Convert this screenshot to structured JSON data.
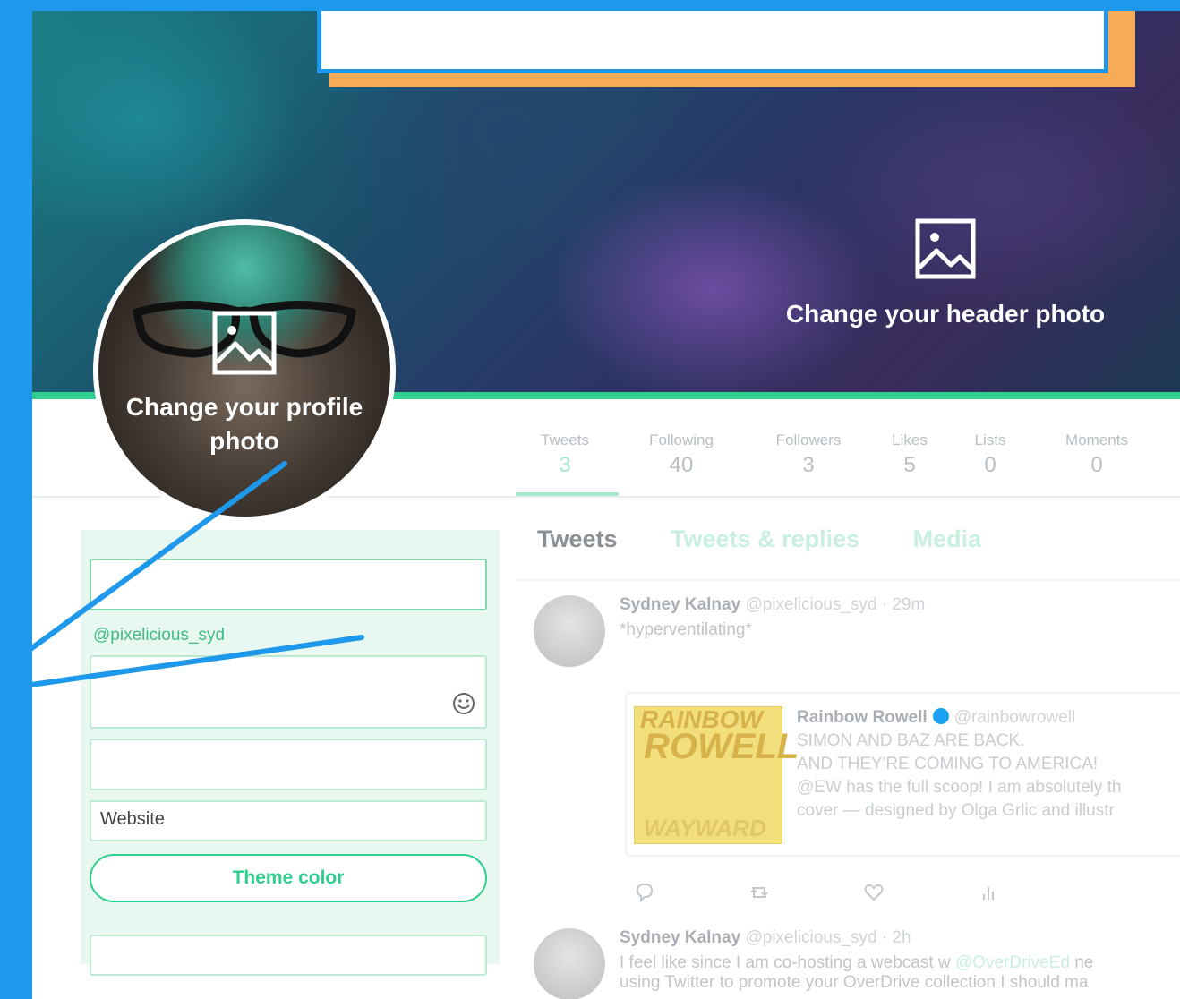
{
  "header": {
    "change_header_label": "Change your header photo"
  },
  "avatar": {
    "change_profile_label": "Change your profile photo"
  },
  "stats": [
    {
      "label": "Tweets",
      "value": "3"
    },
    {
      "label": "Following",
      "value": "40"
    },
    {
      "label": "Followers",
      "value": "3"
    },
    {
      "label": "Likes",
      "value": "5"
    },
    {
      "label": "Lists",
      "value": "0"
    },
    {
      "label": "Moments",
      "value": "0"
    }
  ],
  "form": {
    "handle": "@pixelicious_syd",
    "website_placeholder": "Website",
    "theme_color_label": "Theme color"
  },
  "timeline": {
    "tabs": [
      "Tweets",
      "Tweets & replies",
      "Media"
    ],
    "tweets": [
      {
        "name": "Sydney Kalnay",
        "meta": "@pixelicious_syd · 29m",
        "text": "*hyperventilating*"
      },
      {
        "name": "Sydney Kalnay",
        "meta": "@pixelicious_syd · 2h",
        "text_before": "I feel like since I am co-hosting a webcast w",
        "text_link": "@OverDriveEd",
        "text_after": "ne",
        "text_line2": "using Twitter to promote your OverDrive collection I should ma"
      }
    ],
    "quote": {
      "name": "Rainbow Rowell",
      "handle": "@rainbowrowell",
      "line1": "SIMON AND BAZ ARE BACK.",
      "line2": "AND THEY'RE COMING TO AMERICA!",
      "line3": "@EW has the full scoop! I am absolutely th",
      "line4": "cover — designed by Olga Grlic and illustr",
      "book_title_top": "RAINBOW",
      "book_title_main": "ROWELL",
      "book_title_bottom": "WAYWARD"
    }
  },
  "colors": {
    "accent": "#2ecf8e",
    "callout_border": "#1e98ea",
    "callout_shadow": "#f8ab57"
  }
}
